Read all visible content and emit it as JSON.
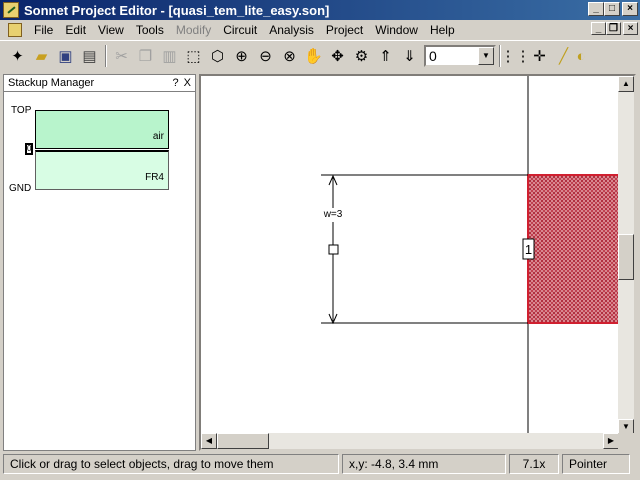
{
  "window": {
    "title": "Sonnet Project Editor - [quasi_tem_lite_easy.son]"
  },
  "menu": {
    "items": [
      {
        "label": "File",
        "disabled": false
      },
      {
        "label": "Edit",
        "disabled": false
      },
      {
        "label": "View",
        "disabled": false
      },
      {
        "label": "Tools",
        "disabled": false
      },
      {
        "label": "Modify",
        "disabled": true
      },
      {
        "label": "Circuit",
        "disabled": false
      },
      {
        "label": "Analysis",
        "disabled": false
      },
      {
        "label": "Project",
        "disabled": false
      },
      {
        "label": "Window",
        "disabled": false
      },
      {
        "label": "Help",
        "disabled": false
      }
    ]
  },
  "toolbar": {
    "level_value": "0"
  },
  "stackup": {
    "title": "Stackup Manager",
    "help": "?",
    "close": "X",
    "top_label": "TOP",
    "gnd_label": "GND",
    "level_marker": "0",
    "layers": [
      {
        "name": "air",
        "color": "#b8f4cc"
      },
      {
        "name": "FR4",
        "color": "#d8fde4"
      }
    ]
  },
  "canvas": {
    "dimension_label": "w=3",
    "port_label": "1",
    "metal_color": "#c04050"
  },
  "status": {
    "hint": "Click or drag to select objects, drag to move them",
    "coords": "x,y: -4.8, 3.4 mm",
    "zoom": "7.1x",
    "mode": "Pointer"
  }
}
